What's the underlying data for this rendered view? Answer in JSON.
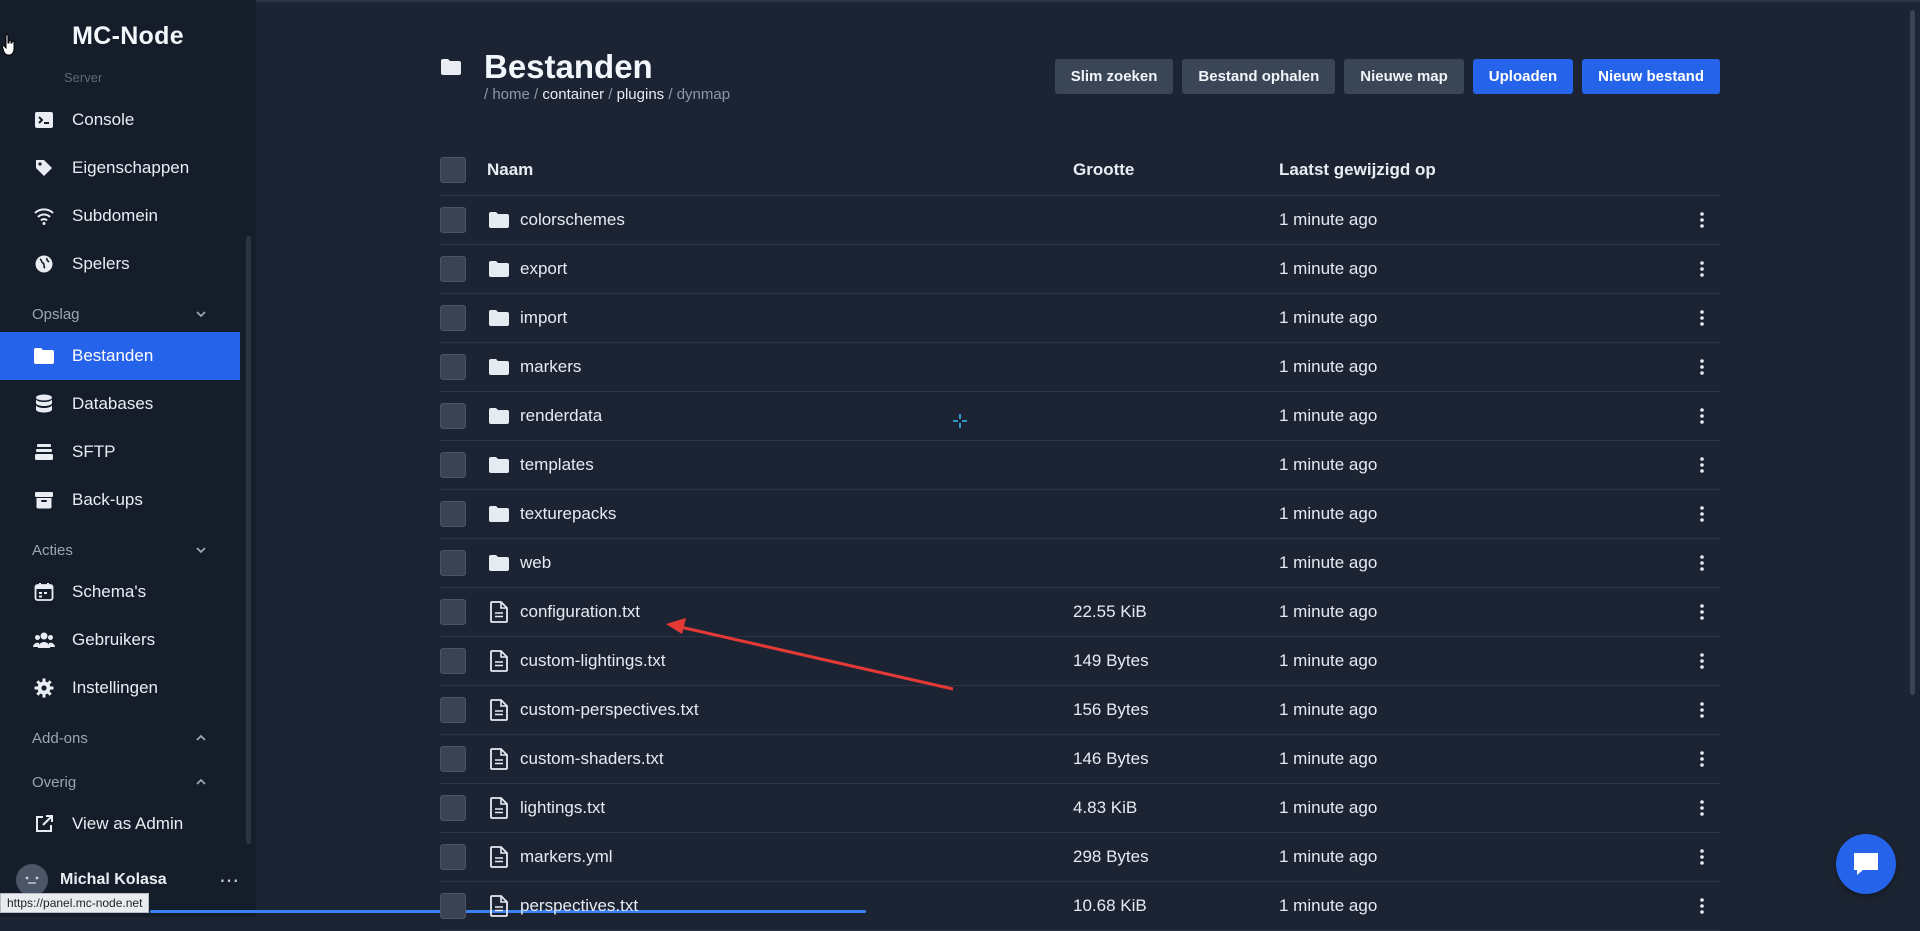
{
  "app": {
    "brand": "MC-Node"
  },
  "sidebar": {
    "section_partial": "Server",
    "items_top": [
      {
        "label": "Console",
        "icon": "terminal-icon"
      },
      {
        "label": "Eigenschappen",
        "icon": "tag-icon"
      },
      {
        "label": "Subdomein",
        "icon": "wifi-icon"
      },
      {
        "label": "Spelers",
        "icon": "globe-icon"
      }
    ],
    "group_opslag": "Opslag",
    "items_opslag": [
      {
        "label": "Bestanden",
        "icon": "folder-icon",
        "active": true
      },
      {
        "label": "Databases",
        "icon": "database-icon"
      },
      {
        "label": "SFTP",
        "icon": "server-stack-icon"
      },
      {
        "label": "Back-ups",
        "icon": "archive-icon"
      }
    ],
    "group_acties": "Acties",
    "items_acties": [
      {
        "label": "Schema's",
        "icon": "calendar-icon"
      },
      {
        "label": "Gebruikers",
        "icon": "users-icon"
      },
      {
        "label": "Instellingen",
        "icon": "gear-icon"
      }
    ],
    "group_addons": "Add-ons",
    "group_overig": "Overig",
    "items_overig": [
      {
        "label": "View as Admin",
        "icon": "external-link-icon"
      }
    ],
    "user": {
      "name": "Michal Kolasa"
    },
    "status_url": "https://panel.mc-node.net"
  },
  "header": {
    "title": "Bestanden",
    "breadcrumb": {
      "sep": "/",
      "home": "home",
      "container": "container",
      "plugins": "plugins",
      "current": "dynmap"
    },
    "actions": {
      "smart_search": "Slim zoeken",
      "fetch_file": "Bestand ophalen",
      "new_folder": "Nieuwe map",
      "upload": "Uploaden",
      "new_file": "Nieuw bestand"
    }
  },
  "table": {
    "headers": {
      "name": "Naam",
      "size": "Grootte",
      "modified": "Laatst gewijzigd op"
    },
    "rows": [
      {
        "name": "colorschemes",
        "type": "folder",
        "size": "",
        "modified": "1 minute ago"
      },
      {
        "name": "export",
        "type": "folder",
        "size": "",
        "modified": "1 minute ago"
      },
      {
        "name": "import",
        "type": "folder",
        "size": "",
        "modified": "1 minute ago"
      },
      {
        "name": "markers",
        "type": "folder",
        "size": "",
        "modified": "1 minute ago"
      },
      {
        "name": "renderdata",
        "type": "folder",
        "size": "",
        "modified": "1 minute ago"
      },
      {
        "name": "templates",
        "type": "folder",
        "size": "",
        "modified": "1 minute ago"
      },
      {
        "name": "texturepacks",
        "type": "folder",
        "size": "",
        "modified": "1 minute ago"
      },
      {
        "name": "web",
        "type": "folder",
        "size": "",
        "modified": "1 minute ago"
      },
      {
        "name": "configuration.txt",
        "type": "file",
        "size": "22.55 KiB",
        "modified": "1 minute ago"
      },
      {
        "name": "custom-lightings.txt",
        "type": "file",
        "size": "149 Bytes",
        "modified": "1 minute ago"
      },
      {
        "name": "custom-perspectives.txt",
        "type": "file",
        "size": "156 Bytes",
        "modified": "1 minute ago"
      },
      {
        "name": "custom-shaders.txt",
        "type": "file",
        "size": "146 Bytes",
        "modified": "1 minute ago"
      },
      {
        "name": "lightings.txt",
        "type": "file",
        "size": "4.83 KiB",
        "modified": "1 minute ago"
      },
      {
        "name": "markers.yml",
        "type": "file",
        "size": "298 Bytes",
        "modified": "1 minute ago"
      },
      {
        "name": "perspectives.txt",
        "type": "file",
        "size": "10.68 KiB",
        "modified": "1 minute ago"
      }
    ]
  },
  "colors": {
    "accent": "#2563eb",
    "annotation_arrow": "#e53935"
  }
}
